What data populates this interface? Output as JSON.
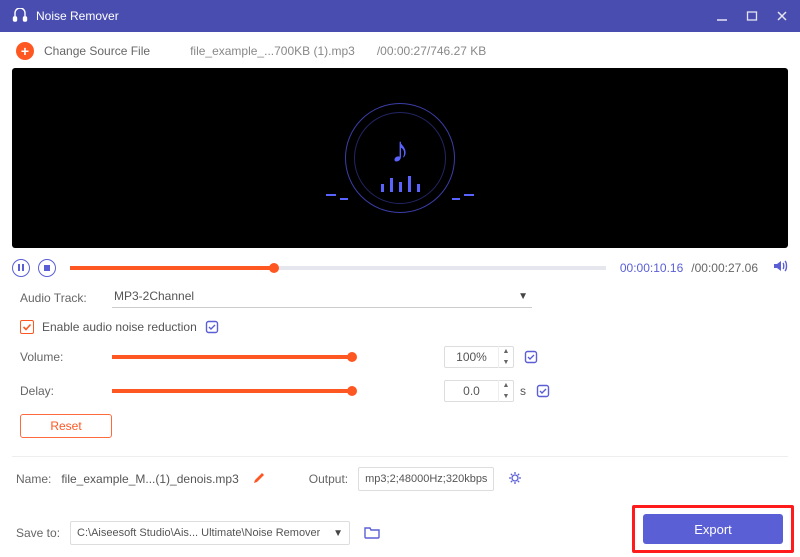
{
  "app": {
    "title": "Noise Remover"
  },
  "topbar": {
    "change_label": "Change Source File",
    "filename": "file_example_...700KB (1).mp3",
    "meta_duration": "/00:00:27",
    "meta_size": "/746.27 KB"
  },
  "playback": {
    "current": "00:00:10.16",
    "total": "/00:00:27.06",
    "progress_pct": 38
  },
  "form": {
    "audio_track_label": "Audio Track:",
    "audio_track_value": "MP3-2Channel",
    "noise_label": "Enable audio noise reduction",
    "volume_label": "Volume:",
    "volume_value": "100%",
    "volume_pct": 100,
    "delay_label": "Delay:",
    "delay_value": "0.0",
    "delay_unit": "s",
    "delay_pct": 100,
    "reset_label": "Reset"
  },
  "output": {
    "name_label": "Name:",
    "name_value": "file_example_M...(1)_denois.mp3",
    "output_label": "Output:",
    "output_value": "mp3;2;48000Hz;320kbps",
    "save_label": "Save to:",
    "save_value": "C:\\Aiseesoft Studio\\Ais... Ultimate\\Noise Remover",
    "export_label": "Export"
  }
}
